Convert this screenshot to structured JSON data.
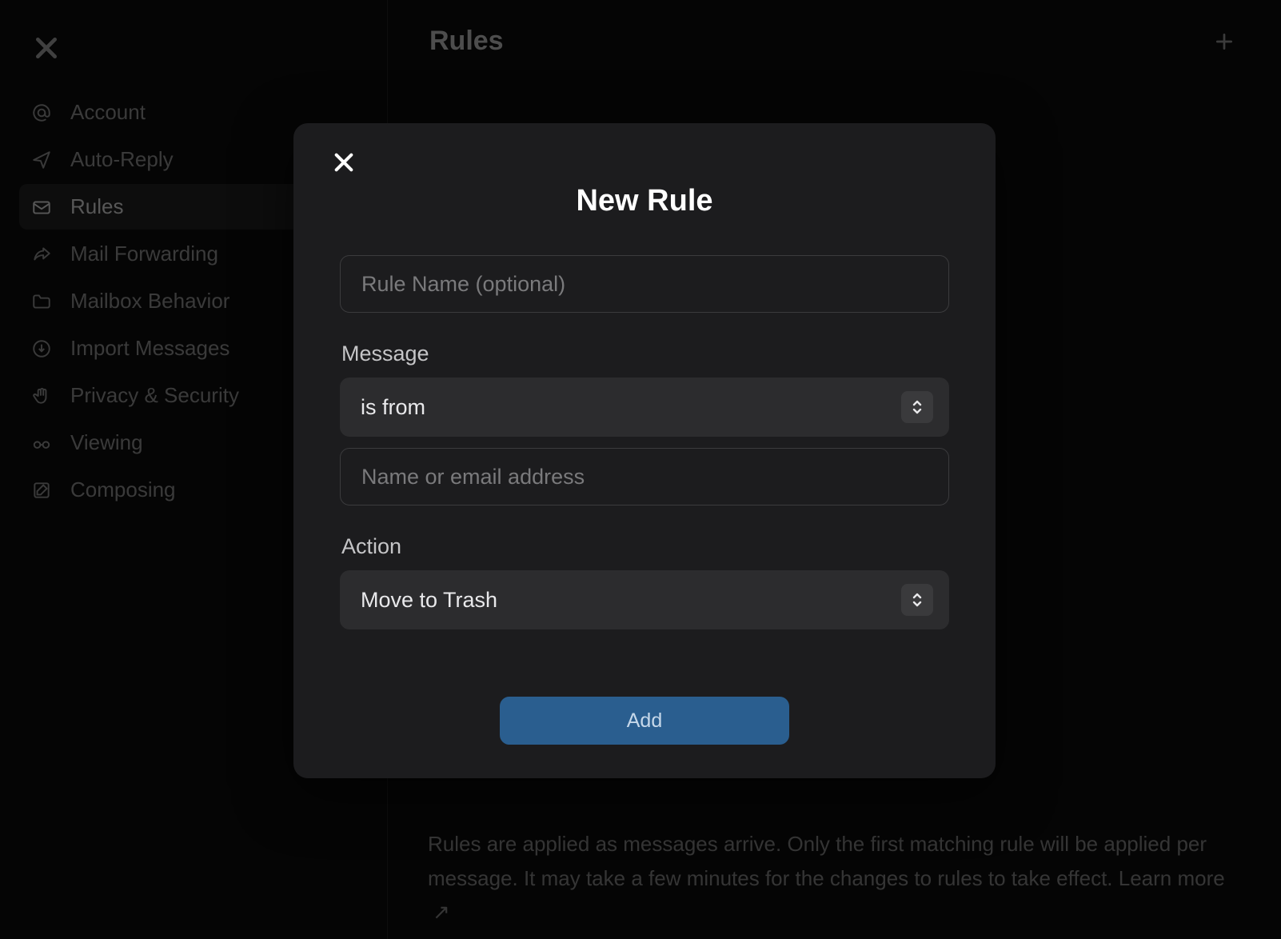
{
  "sidebar": {
    "items": [
      {
        "label": "Account",
        "icon": "at"
      },
      {
        "label": "Auto-Reply",
        "icon": "plane"
      },
      {
        "label": "Rules",
        "icon": "envelope-gear",
        "active": true
      },
      {
        "label": "Mail Forwarding",
        "icon": "share"
      },
      {
        "label": "Mailbox Behavior",
        "icon": "folder"
      },
      {
        "label": "Import Messages",
        "icon": "download-circle"
      },
      {
        "label": "Privacy & Security",
        "icon": "hand"
      },
      {
        "label": "Viewing",
        "icon": "glasses"
      },
      {
        "label": "Composing",
        "icon": "compose"
      }
    ]
  },
  "main": {
    "title": "Rules",
    "footer_text": "Rules are applied as messages arrive. Only the first matching rule will be applied per message. It may take a few minutes for the changes to rules to take effect.",
    "learn_more_label": "Learn more"
  },
  "modal": {
    "title": "New Rule",
    "rule_name_placeholder": "Rule Name (optional)",
    "message_label": "Message",
    "condition_select_value": "is from",
    "condition_value_placeholder": "Name or email address",
    "action_label": "Action",
    "action_select_value": "Move to Trash",
    "add_button_label": "Add"
  }
}
